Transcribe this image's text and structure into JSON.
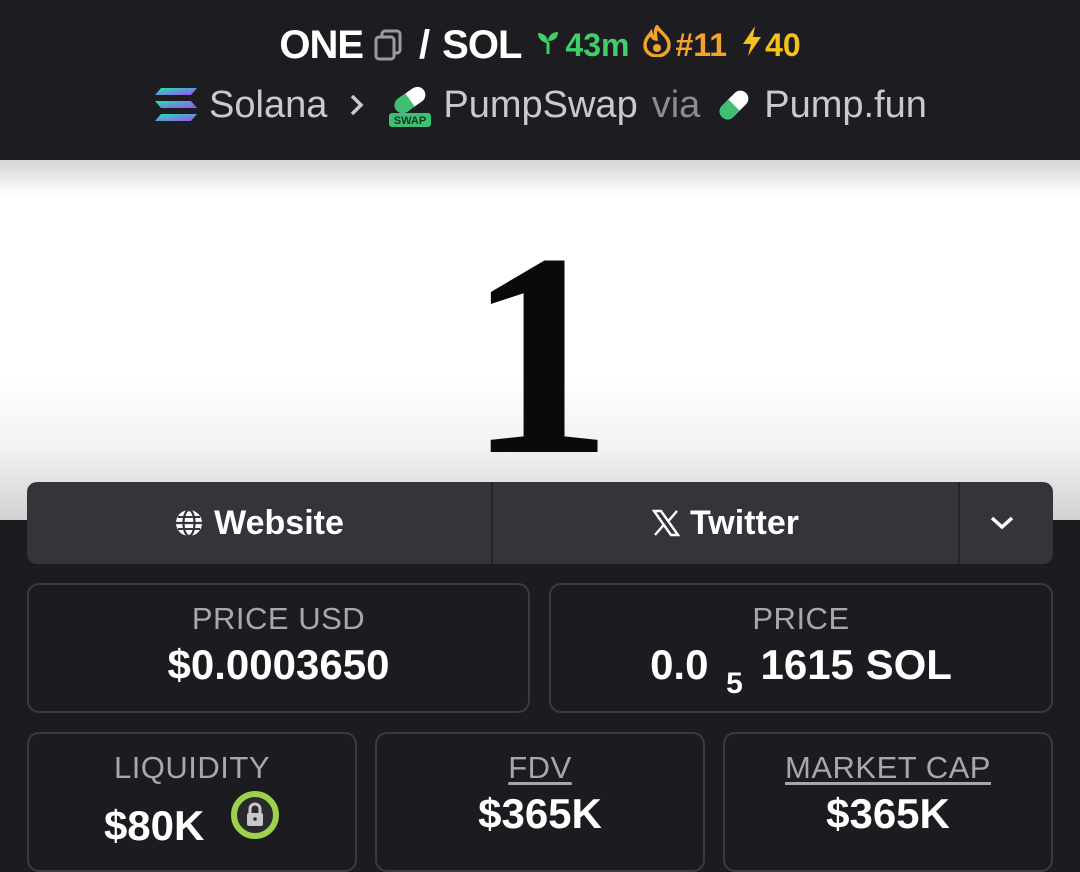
{
  "header": {
    "base_symbol": "ONE",
    "slash": "/",
    "quote_symbol": "SOL",
    "age": "43m",
    "rank": "#11",
    "boosts": "40",
    "chain": "Solana",
    "dex": "PumpSwap",
    "via_label": "via",
    "launchpad": "Pump.fun",
    "dex_badge": "SWAP"
  },
  "banner": {
    "text": "1"
  },
  "links": {
    "website": "Website",
    "twitter": "Twitter"
  },
  "stats": {
    "price_usd_label": "PRICE USD",
    "price_usd": "$0.0003650",
    "price_label": "PRICE",
    "price_prefix": "0.0",
    "price_zeros": "5",
    "price_digits": "1615 SOL",
    "liquidity_label": "LIQUIDITY",
    "liquidity": "$80K",
    "fdv_label": "FDV",
    "fdv": "$365K",
    "mcap_label": "MARKET CAP",
    "mcap": "$365K"
  },
  "colors": {
    "age_green": "#3ecf6b",
    "rank_orange": "#f2a32b",
    "boost_yellow": "#f4c21b",
    "lock_green": "#9bd34d"
  }
}
